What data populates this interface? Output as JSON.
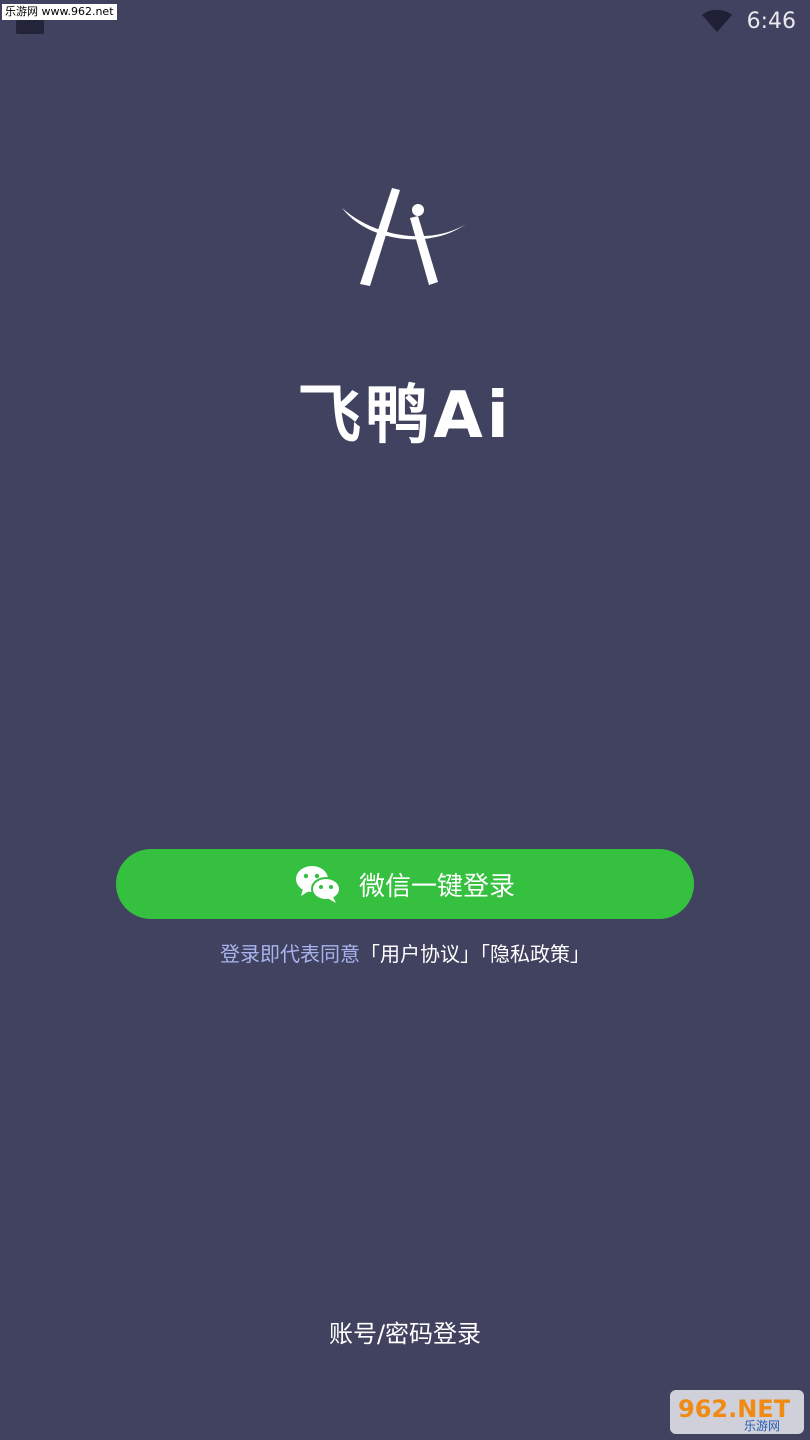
{
  "watermark_top": "乐游网 www.962.net",
  "status_bar": {
    "time": "6:46"
  },
  "app": {
    "name": "飞鸭Ai"
  },
  "wechat_login": {
    "label": "微信一键登录"
  },
  "agreement": {
    "prefix": "登录即代表同意",
    "user_agreement": "「用户协议」",
    "privacy_policy": "「隐私政策」"
  },
  "account_login": {
    "label": "账号/密码登录"
  },
  "watermark_bottom": {
    "brand": "962.NET",
    "subtitle": "乐游网"
  },
  "colors": {
    "background": "#40425f",
    "wechat_green": "#35c03f",
    "agreement_prefix": "#a9b4ee"
  },
  "icons": {
    "logo": "feiya-ai-logo",
    "wifi": "wifi-icon",
    "wechat": "wechat-icon"
  }
}
